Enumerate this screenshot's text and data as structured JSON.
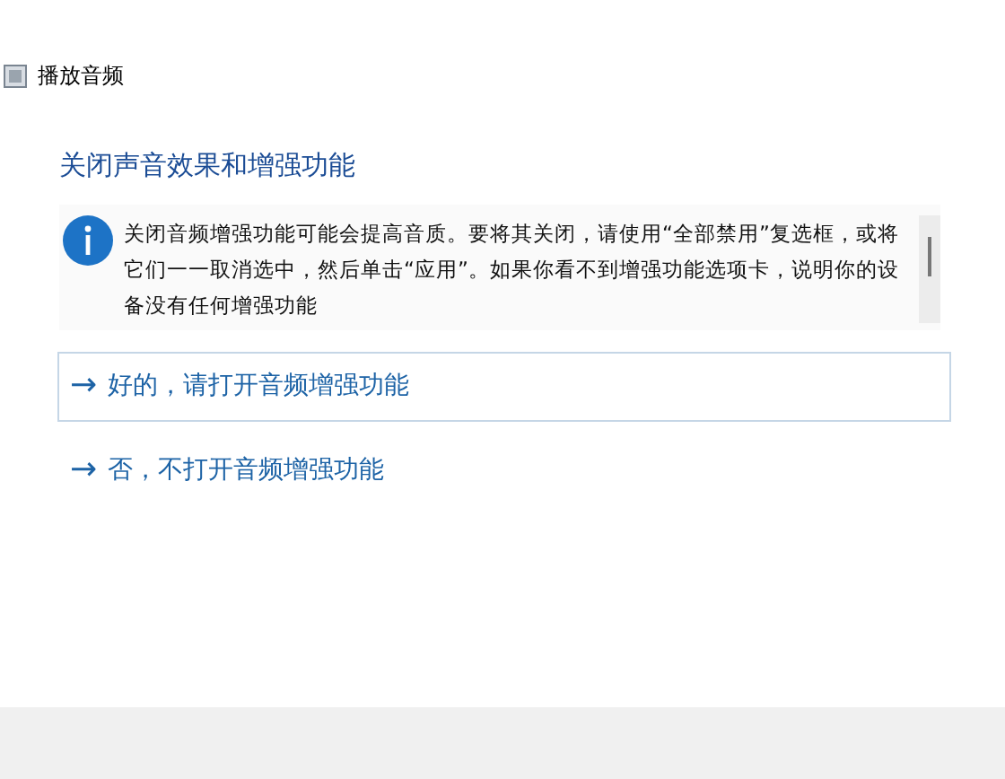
{
  "window": {
    "title": "播放音频"
  },
  "heading": "关闭声音效果和增强功能",
  "info": {
    "text": "关闭音频增强功能可能会提高音质。要将其关闭，请使用“全部禁用”复选框，或将它们一一取消选中，然后单击“应用”。如果你看不到增强功能选项卡，说明你的设备没有任何增强功能"
  },
  "options": [
    {
      "arrow": "→",
      "label": "好的，请打开音频增强功能",
      "highlighted": true
    },
    {
      "arrow": "→",
      "label": "否，不打开音频增强功能",
      "highlighted": false
    }
  ]
}
